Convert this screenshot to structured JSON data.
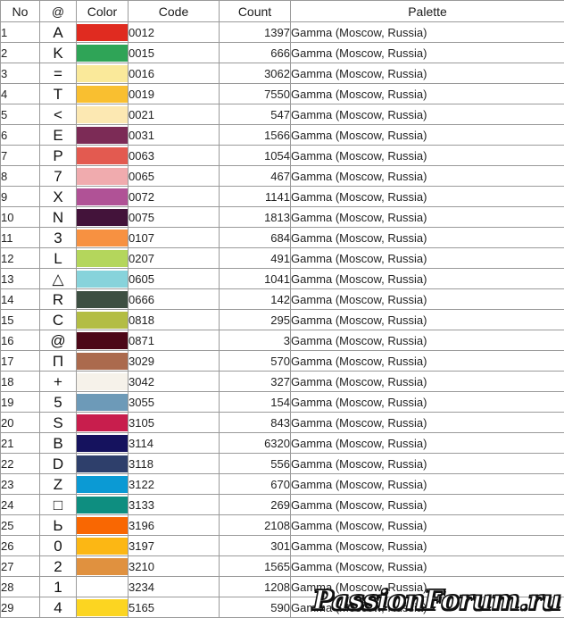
{
  "table": {
    "headers": {
      "no": "No",
      "symbol": "@",
      "color": "Color",
      "code": "Code",
      "count": "Count",
      "palette": "Palette"
    },
    "palette_name": "Gamma (Moscow, Russia)",
    "row_count": 29,
    "rows": [
      {
        "no": "1",
        "symbol": "A",
        "color": "#e02b20",
        "code": "0012",
        "count": "1397",
        "palette": "Gamma (Moscow, Russia)"
      },
      {
        "no": "2",
        "symbol": "K",
        "color": "#2fa457",
        "code": "0015",
        "count": "666",
        "palette": "Gamma (Moscow, Russia)"
      },
      {
        "no": "3",
        "symbol": "=",
        "color": "#fae99a",
        "code": "0016",
        "count": "3062",
        "palette": "Gamma (Moscow, Russia)"
      },
      {
        "no": "4",
        "symbol": "T",
        "color": "#f9bf30",
        "code": "0019",
        "count": "7550",
        "palette": "Gamma (Moscow, Russia)"
      },
      {
        "no": "5",
        "symbol": "<",
        "color": "#fce8b2",
        "code": "0021",
        "count": "547",
        "palette": "Gamma (Moscow, Russia)"
      },
      {
        "no": "6",
        "symbol": "E",
        "color": "#7c2b56",
        "code": "0031",
        "count": "1566",
        "palette": "Gamma (Moscow, Russia)"
      },
      {
        "no": "7",
        "symbol": "P",
        "color": "#e35a50",
        "code": "0063",
        "count": "1054",
        "palette": "Gamma (Moscow, Russia)"
      },
      {
        "no": "8",
        "symbol": "7",
        "color": "#f0abae",
        "code": "0065",
        "count": "467",
        "palette": "Gamma (Moscow, Russia)"
      },
      {
        "no": "9",
        "symbol": "X",
        "color": "#b05296",
        "code": "0072",
        "count": "1141",
        "palette": "Gamma (Moscow, Russia)"
      },
      {
        "no": "10",
        "symbol": "N",
        "color": "#43133a",
        "code": "0075",
        "count": "1813",
        "palette": "Gamma (Moscow, Russia)"
      },
      {
        "no": "11",
        "symbol": "3",
        "color": "#f79141",
        "code": "0107",
        "count": "684",
        "palette": "Gamma (Moscow, Russia)"
      },
      {
        "no": "12",
        "symbol": "L",
        "color": "#b4d65c",
        "code": "0207",
        "count": "491",
        "palette": "Gamma (Moscow, Russia)"
      },
      {
        "no": "13",
        "symbol": "△",
        "color": "#87d3db",
        "code": "0605",
        "count": "1041",
        "palette": "Gamma (Moscow, Russia)"
      },
      {
        "no": "14",
        "symbol": "R",
        "color": "#3d4f42",
        "code": "0666",
        "count": "142",
        "palette": "Gamma (Moscow, Russia)"
      },
      {
        "no": "15",
        "symbol": "C",
        "color": "#b3bd44",
        "code": "0818",
        "count": "295",
        "palette": "Gamma (Moscow, Russia)"
      },
      {
        "no": "16",
        "symbol": "@",
        "color": "#4d0718",
        "code": "0871",
        "count": "3",
        "palette": "Gamma (Moscow, Russia)"
      },
      {
        "no": "17",
        "symbol": "П",
        "color": "#ab6a4d",
        "code": "3029",
        "count": "570",
        "palette": "Gamma (Moscow, Russia)"
      },
      {
        "no": "18",
        "symbol": "+",
        "color": "#f6f2ea",
        "code": "3042",
        "count": "327",
        "palette": "Gamma (Moscow, Russia)"
      },
      {
        "no": "19",
        "symbol": "5",
        "color": "#6d9ab8",
        "code": "3055",
        "count": "154",
        "palette": "Gamma (Moscow, Russia)"
      },
      {
        "no": "20",
        "symbol": "S",
        "color": "#c81e4d",
        "code": "3105",
        "count": "843",
        "palette": "Gamma (Moscow, Russia)"
      },
      {
        "no": "21",
        "symbol": "B",
        "color": "#15125e",
        "code": "3114",
        "count": "6320",
        "palette": "Gamma (Moscow, Russia)"
      },
      {
        "no": "22",
        "symbol": "D",
        "color": "#2e3f6b",
        "code": "3118",
        "count": "556",
        "palette": "Gamma (Moscow, Russia)"
      },
      {
        "no": "23",
        "symbol": "Z",
        "color": "#0b9ad4",
        "code": "3122",
        "count": "670",
        "palette": "Gamma (Moscow, Russia)"
      },
      {
        "no": "24",
        "symbol": "□",
        "color": "#0e8e80",
        "code": "3133",
        "count": "269",
        "palette": "Gamma (Moscow, Russia)"
      },
      {
        "no": "25",
        "symbol": "Ь",
        "color": "#f96702",
        "code": "3196",
        "count": "2108",
        "palette": "Gamma (Moscow, Russia)"
      },
      {
        "no": "26",
        "symbol": "0",
        "color": "#fcb714",
        "code": "3197",
        "count": "301",
        "palette": "Gamma (Moscow, Russia)"
      },
      {
        "no": "27",
        "symbol": "2",
        "color": "#e0913f",
        "code": "3210",
        "count": "1565",
        "palette": "Gamma (Moscow, Russia)"
      },
      {
        "no": "28",
        "symbol": "1",
        "color": "#ffffff",
        "code": "3234",
        "count": "1208",
        "palette": "Gamma (Moscow, Russia)"
      },
      {
        "no": "29",
        "symbol": "4",
        "color": "#fcd521",
        "code": "5165",
        "count": "590",
        "palette": "Gamma (Moscow, Russia)"
      }
    ]
  },
  "watermark": {
    "text": "PassionForum.ru"
  }
}
